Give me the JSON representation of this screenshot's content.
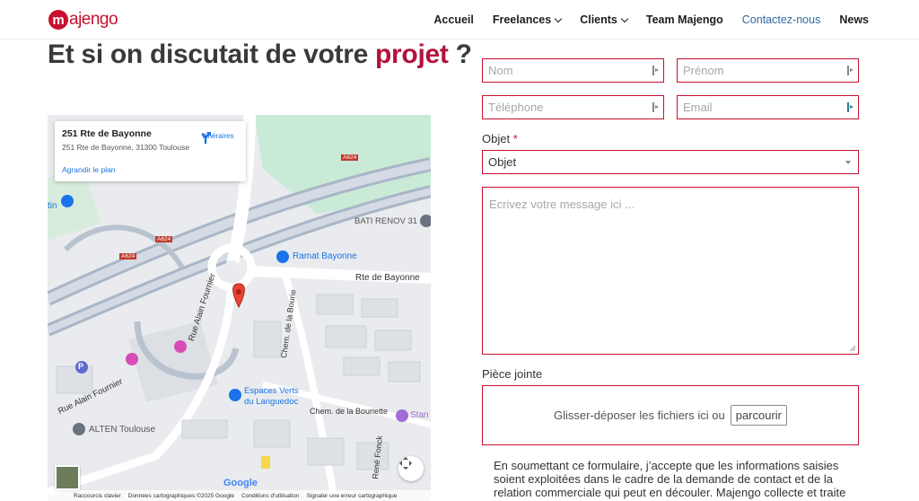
{
  "brand": {
    "logo_mark": "m",
    "logo_text": "ajengo",
    "accent_color": "#c8102e"
  },
  "nav": {
    "items": [
      {
        "label": "Accueil",
        "dropdown": false,
        "active": false
      },
      {
        "label": "Freelances",
        "dropdown": true,
        "active": false
      },
      {
        "label": "Clients",
        "dropdown": true,
        "active": false
      },
      {
        "label": "Team Majengo",
        "dropdown": false,
        "active": false
      },
      {
        "label": "Contactez-nous",
        "dropdown": false,
        "active": true
      },
      {
        "label": "News",
        "dropdown": false,
        "active": false
      }
    ]
  },
  "heading": {
    "prefix": "Et si on discutait de votre",
    "accent": "projet",
    "suffix": "?"
  },
  "map": {
    "card": {
      "title": "251 Rte de Bayonne",
      "address": "251 Rte de Bayonne, 31300 Toulouse",
      "enlarge_link": "Agrandir le plan",
      "directions_label": "Itinéraires"
    },
    "labels": {
      "bati": "BATI RENOV 31",
      "ramat": "Ramat Bayonne",
      "rte": "Rte de Bayonne",
      "alain": "Rue Alain Fournier",
      "alain2": "Rue Alain Fournier",
      "bourie": "Chem. de la Bourie",
      "bourie2": "Chem. de la Bouriette",
      "espaces1": "Espaces Verts",
      "espaces2": "du Languedoc",
      "alten": "ALTEN Toulouse",
      "a624a": "A624",
      "a624b": "A624",
      "a624c": "A624",
      "fonck": "René Fonck",
      "stan": "Stan",
      "tin": "tin",
      "parking": "P"
    },
    "google": "Google",
    "footer": [
      "Raccourcis clavier",
      "Données cartographiques ©2025 Google",
      "Conditions d'utilisation",
      "Signaler une erreur cartographique"
    ]
  },
  "form": {
    "nom_placeholder": "Nom",
    "prenom_placeholder": "Prénom",
    "telephone_placeholder": "Téléphone",
    "email_placeholder": "Email",
    "objet_label": "Objet",
    "required_mark": "*",
    "objet_selected": "Objet",
    "message_placeholder": "Ecrivez votre message ici ...",
    "attachment_label": "Pièce jointe",
    "dropzone_text": "Glisser-déposer les fichiers ici ou",
    "browse_label": "parcourir",
    "consent_text": "En soumettant ce formulaire, j’accepte que les informations saisies soient exploitées dans le cadre de la demande de contact et de la relation commerciale qui peut en découler. Majengo collecte et traite les données que"
  }
}
